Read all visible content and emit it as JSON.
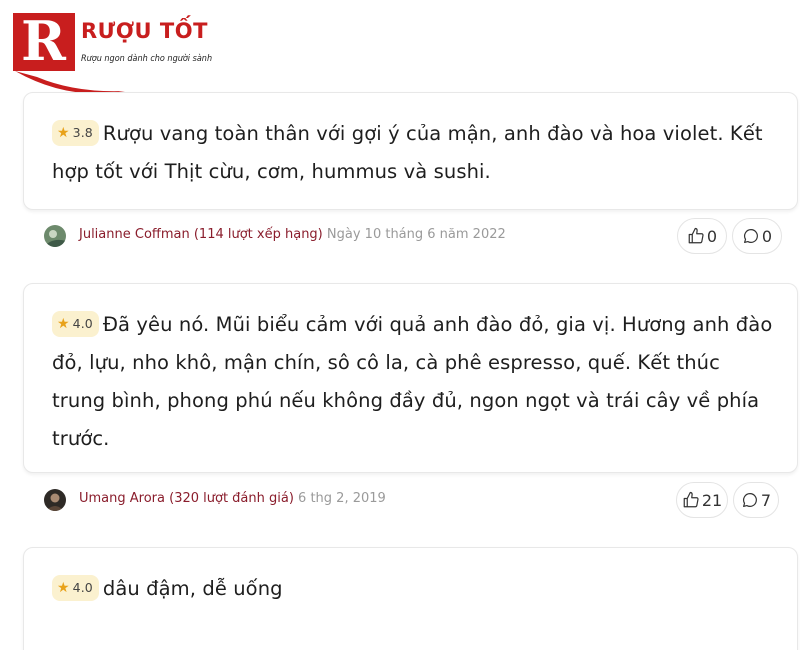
{
  "brand": {
    "title": "RƯỢU TỐT",
    "tagline": "Rượu ngon dành cho người sành",
    "logo_letter": "R",
    "color": "#c81e1e"
  },
  "reviews": [
    {
      "rating": "3.8",
      "text": "Rượu vang toàn thân với gợi ý của mận, anh đào và hoa violet. Kết hợp tốt với Thịt cừu, cơm, hummus và sushi.",
      "author": "Julianne Coffman (114 lượt xếp hạng)",
      "date": "Ngày 10 tháng 6 năm 2022",
      "likes": "0",
      "comments": "0"
    },
    {
      "rating": "4.0",
      "text": "Đã yêu nó. Mũi biểu cảm với quả anh đào đỏ, gia vị. Hương anh đào đỏ, lựu, nho khô, mận chín, sô cô la, cà phê espresso, quế. Kết thúc trung bình, phong phú nếu không đầy đủ, ngon ngọt và trái cây về phía trước.",
      "author": "Umang Arora (320 lượt đánh giá)",
      "date": "6 thg 2, 2019",
      "likes": "21",
      "comments": "7"
    },
    {
      "rating": "4.0",
      "text": "dâu đậm, dễ uống"
    }
  ],
  "icons": {
    "rating": "star-icon",
    "like": "thumbs-up-icon",
    "comment": "comment-icon"
  },
  "colors": {
    "star": "#e8a21a",
    "badge_bg": "#fbf1cf",
    "author": "#8a1d2c",
    "date": "#9a9a9a"
  }
}
